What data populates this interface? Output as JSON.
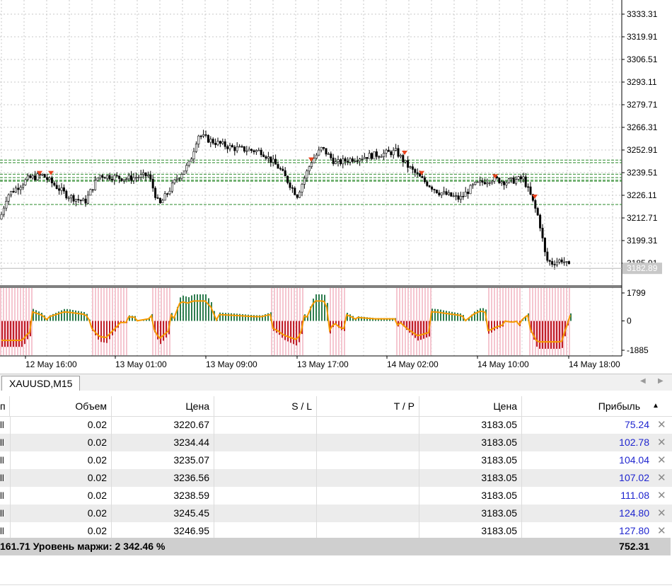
{
  "chart": {
    "price_axis": [
      "3333.31",
      "3319.91",
      "3306.51",
      "3293.11",
      "3279.71",
      "3266.31",
      "3252.91",
      "3239.51",
      "3226.11",
      "3212.71",
      "3199.31",
      "3185.91"
    ],
    "current_price": "3182.89",
    "indicator_axis": [
      "1799",
      "0",
      "-1885"
    ],
    "time_axis": [
      "12 May 16:00",
      "13 May 01:00",
      "13 May 09:00",
      "13 May 17:00",
      "14 May 02:00",
      "14 May 10:00",
      "14 May 18:00"
    ],
    "open_position_prices": [
      3220.67,
      3234.44,
      3235.07,
      3236.56,
      3238.59,
      3245.45,
      3246.95
    ],
    "colors": {
      "bull_bar": "#2e7d4f",
      "bear_bar": "#c0202a",
      "shade": "#f5c6d0",
      "signal_line": "#f59a00",
      "level_line": "#2a8a2a",
      "marker": "#e8431e"
    }
  },
  "tab": {
    "symbol": "XAUUSD,M15",
    "prev_icon": "chevron-left-icon",
    "next_icon": "chevron-right-icon"
  },
  "table": {
    "headers": {
      "type": "п",
      "volume": "Объем",
      "price": "Цена",
      "sl": "S / L",
      "tp": "T / P",
      "current": "Цена",
      "profit": "Прибыль"
    },
    "sort_icon": "sort-up-triangle-icon",
    "rows": [
      {
        "type": "ll",
        "volume": "0.02",
        "price": "3220.67",
        "sl": "",
        "tp": "",
        "current": "3183.05",
        "profit": "75.24"
      },
      {
        "type": "ll",
        "volume": "0.02",
        "price": "3234.44",
        "sl": "",
        "tp": "",
        "current": "3183.05",
        "profit": "102.78"
      },
      {
        "type": "ll",
        "volume": "0.02",
        "price": "3235.07",
        "sl": "",
        "tp": "",
        "current": "3183.05",
        "profit": "104.04"
      },
      {
        "type": "ll",
        "volume": "0.02",
        "price": "3236.56",
        "sl": "",
        "tp": "",
        "current": "3183.05",
        "profit": "107.02"
      },
      {
        "type": "ll",
        "volume": "0.02",
        "price": "3238.59",
        "sl": "",
        "tp": "",
        "current": "3183.05",
        "profit": "111.08"
      },
      {
        "type": "ll",
        "volume": "0.02",
        "price": "3245.45",
        "sl": "",
        "tp": "",
        "current": "3183.05",
        "profit": "124.80"
      },
      {
        "type": "ll",
        "volume": "0.02",
        "price": "3246.95",
        "sl": "",
        "tp": "",
        "current": "3183.05",
        "profit": "127.80"
      }
    ],
    "summary": {
      "left": "161.71  Уровень маржи: 2 342.46 %",
      "total": "752.31"
    }
  }
}
